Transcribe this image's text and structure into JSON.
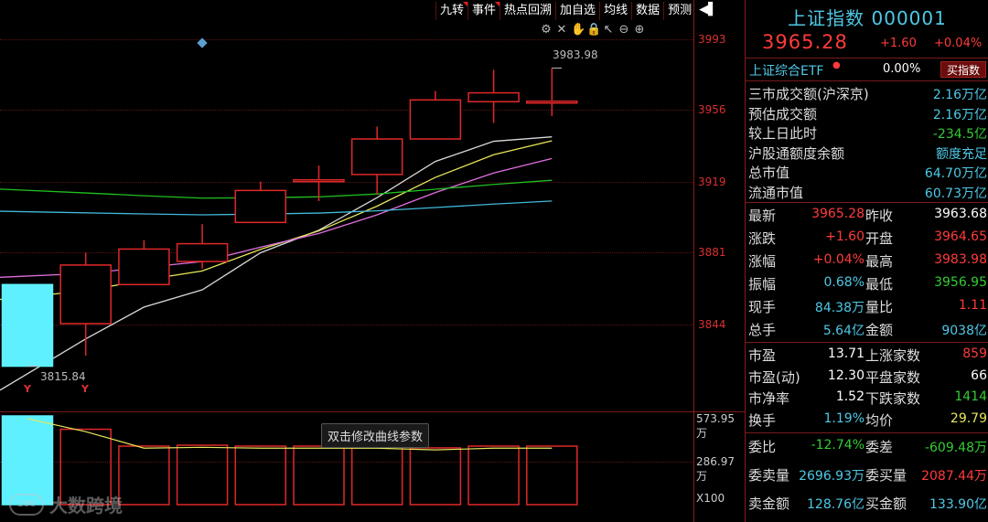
{
  "toolbar": {
    "buttons": [
      "九转",
      "事件",
      "热点回溯",
      "加自选",
      "均线",
      "数据",
      "预测"
    ],
    "arrow": "◀▌"
  },
  "price_axis": {
    "labels": [
      "3993",
      "3956",
      "3919",
      "3881",
      "3844"
    ],
    "volume_labels": [
      "573.95万",
      "286.97万",
      "X100"
    ]
  },
  "annotations": {
    "high": "3983.98",
    "low": "3815.84",
    "y_marks": [
      "Y",
      "Y"
    ],
    "tooltip": "双击修改曲线参数"
  },
  "watermark": {
    "text": "大数跨境",
    "logo": "100"
  },
  "colors": {
    "up": "#e02828",
    "down": "#5ef0ff",
    "ma5": "#d8d8d8",
    "ma10": "#e6e65a",
    "ma20": "#e070e0",
    "ma60": "#20c020",
    "ma120": "#40b8d8"
  },
  "chart_data": {
    "type": "candlestick",
    "ylim": [
      3806,
      4012
    ],
    "candles": [
      {
        "open": 3862,
        "close": 3816,
        "high": 3862,
        "low": 3816
      },
      {
        "open": 3840,
        "close": 3873,
        "high": 3880,
        "low": 3822
      },
      {
        "open": 3862,
        "close": 3882,
        "high": 3887,
        "low": 3862
      },
      {
        "open": 3875,
        "close": 3885,
        "high": 3896,
        "low": 3871
      },
      {
        "open": 3897,
        "close": 3915,
        "high": 3920,
        "low": 3897
      },
      {
        "open": 3920,
        "close": 3921,
        "high": 3929,
        "low": 3909
      },
      {
        "open": 3924,
        "close": 3944,
        "high": 3951,
        "low": 3913
      },
      {
        "open": 3944,
        "close": 3966,
        "high": 3971,
        "low": 3944
      },
      {
        "open": 3965,
        "close": 3970,
        "high": 3983,
        "low": 3953
      },
      {
        "open": 3964.65,
        "close": 3965.28,
        "high": 3983.98,
        "low": 3956.95
      }
    ],
    "volumes": [
      100,
      85,
      66,
      67,
      66,
      66,
      66,
      64,
      66,
      66
    ]
  },
  "header": {
    "title": "上证指数 000001",
    "price": "3965.28",
    "change": "+1.60",
    "pct": "+0.04%"
  },
  "etf": {
    "name": "上证综合ETF",
    "dot": "●",
    "pct": "0.00%",
    "buy": "买指数"
  },
  "market": [
    {
      "label": "三市成交额(沪深京)",
      "value": "2.16万亿",
      "color": "cyan"
    },
    {
      "label": "预估成交额",
      "value": "2.16万亿",
      "color": "cyan"
    },
    {
      "label": "较上日此时",
      "value": "-234.5亿",
      "color": "green"
    },
    {
      "label": "沪股通额度余额",
      "value": "额度充足",
      "color": "cyan"
    },
    {
      "label": "总市值",
      "value": "64.70万亿",
      "color": "cyan"
    },
    {
      "label": "流通市值",
      "value": "60.73万亿",
      "color": "cyan"
    }
  ],
  "quote_grid": [
    {
      "l1": "最新",
      "v1": "3965.28",
      "c1": "red",
      "l2": "昨收",
      "v2": "3963.68",
      "c2": "white"
    },
    {
      "l1": "涨跌",
      "v1": "+1.60",
      "c1": "red",
      "l2": "开盘",
      "v2": "3964.65",
      "c2": "red"
    },
    {
      "l1": "涨幅",
      "v1": "+0.04%",
      "c1": "red",
      "l2": "最高",
      "v2": "3983.98",
      "c2": "red"
    },
    {
      "l1": "振幅",
      "v1": "0.68%",
      "c1": "cyan",
      "l2": "最低",
      "v2": "3956.95",
      "c2": "green"
    },
    {
      "l1": "现手",
      "v1": "84.38万",
      "c1": "cyan",
      "l2": "量比",
      "v2": "1.11",
      "c2": "red"
    },
    {
      "l1": "总手",
      "v1": "5.64亿",
      "c1": "cyan",
      "l2": "金额",
      "v2": "9038亿",
      "c2": "cyan"
    }
  ],
  "breadth_grid": [
    {
      "l1": "市盈",
      "v1": "13.71",
      "c1": "white",
      "l2": "上涨家数",
      "v2": "859",
      "c2": "red"
    },
    {
      "l1": "市盈(动)",
      "v1": "12.30",
      "c1": "white",
      "l2": "平盘家数",
      "v2": "66",
      "c2": "white"
    },
    {
      "l1": "市净率",
      "v1": "1.52",
      "c1": "white",
      "l2": "下跌家数",
      "v2": "1414",
      "c2": "green"
    },
    {
      "l1": "换手",
      "v1": "1.19%",
      "c1": "cyan",
      "l2": "均价",
      "v2": "29.79",
      "c2": "yellow"
    }
  ],
  "order_grid": [
    {
      "l1": "委比",
      "v1": "-12.74%",
      "c1": "green",
      "l2": "委差",
      "v2": "-609.48万",
      "c2": "green"
    },
    {
      "l1": "委卖量",
      "v1": "2696.93万",
      "c1": "cyan",
      "l2": "委买量",
      "v2": "2087.44万",
      "c2": "red"
    },
    {
      "l1": "卖金额",
      "v1": "128.76亿",
      "c1": "cyan",
      "l2": "买金额",
      "v2": "133.90亿",
      "c2": "cyan"
    }
  ]
}
